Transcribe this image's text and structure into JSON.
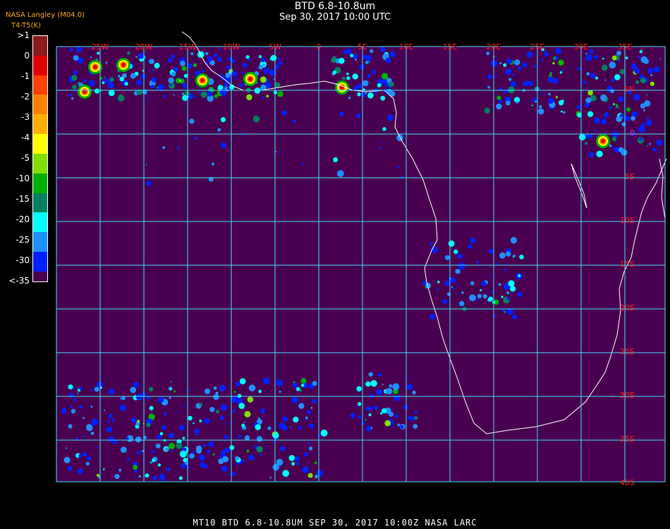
{
  "title": "BTD 6.8-10.8um",
  "subtitle": "Sep 30, 2017 10:00 UTC",
  "credit": "NASA Langley (M04.0)",
  "unit_label": "T4-T5(K)",
  "footer": "MT10  BTD 6.8-10.8UM    SEP 30, 2017 10:00Z   NASA LARC",
  "colorbar": {
    "labels": [
      ">1",
      "0",
      "-1",
      "-2",
      "-3",
      "-4",
      "-5",
      "-10",
      "-15",
      "-20",
      "-25",
      "-30",
      "<-35"
    ],
    "colors": [
      "#8b1a1a",
      "#e00000",
      "#ff4000",
      "#ff8000",
      "#ffb000",
      "#ffff00",
      "#80e000",
      "#00b000",
      "#008060",
      "#00ffff",
      "#1e90ff",
      "#0020ff",
      "#4a0050"
    ]
  },
  "map": {
    "background": "#4a0050",
    "grid_color": "#40e0ff",
    "label_color": "#ff2020",
    "coast_color": "#ffffff",
    "lon_labels": [
      "25W",
      "20W",
      "15W",
      "10W",
      "5W",
      "0",
      "5E",
      "10E",
      "15E",
      "20E",
      "25E",
      "30E",
      "35E"
    ],
    "lat_labels": [
      "5N",
      "0",
      "5S",
      "10S",
      "15S",
      "20S",
      "25S",
      "30S",
      "35S",
      "40S"
    ]
  }
}
